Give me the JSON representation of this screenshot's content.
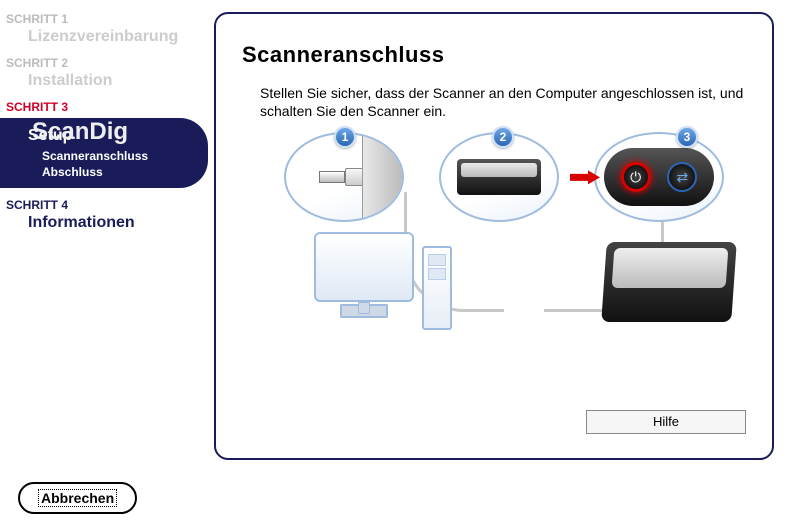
{
  "sidebar": {
    "step1_label": "SCHRITT 1",
    "step1_name": "Lizenzvereinbarung",
    "step2_label": "SCHRITT 2",
    "step2_name": "Installation",
    "step3_label": "SCHRITT 3",
    "setup": "Setup",
    "sub1": "Scanneranschluss",
    "sub2": "Abschluss",
    "step4_label": "SCHRITT 4",
    "step4_name": "Informationen"
  },
  "panel": {
    "title": "Scanneranschluss",
    "body": "Stellen Sie sicher, dass der Scanner an den Computer angeschlossen ist, und schalten Sie den Scanner ein.",
    "badge1": "1",
    "badge2": "2",
    "badge3": "3",
    "help": "Hilfe"
  },
  "footer": {
    "cancel": "Abbrechen"
  },
  "watermark": "ScanDig"
}
